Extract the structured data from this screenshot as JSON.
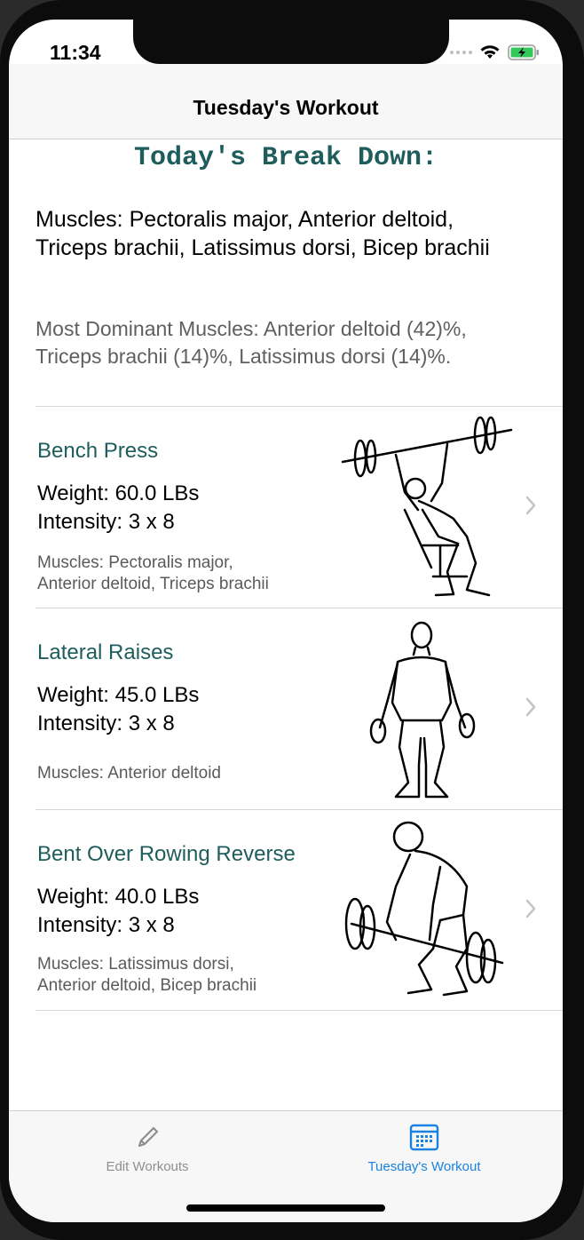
{
  "status": {
    "time": "11:34"
  },
  "nav": {
    "title": "Tuesday's Workout"
  },
  "summary": {
    "heading": "Today's Break Down:",
    "muscles_line1": "Muscles: Pectoralis major, Anterior deltoid,",
    "muscles_line2": "Triceps brachii, Latissimus dorsi, Bicep brachii",
    "dominant_line1": "Most Dominant Muscles: Anterior deltoid (42)%,",
    "dominant_line2": "Triceps brachii (14)%, Latissimus dorsi (14)%."
  },
  "exercises": [
    {
      "name": "Bench Press",
      "weight": "Weight: 60.0 LBs",
      "intensity": "Intensity: 3 x 8",
      "muscles_line1": "Muscles: Pectoralis major,",
      "muscles_line2": "Anterior deltoid, Triceps brachii",
      "image_icon": "bench-press-illustration"
    },
    {
      "name": "Lateral Raises",
      "weight": "Weight: 45.0 LBs",
      "intensity": "Intensity: 3 x 8",
      "muscles_line1": "Muscles: Anterior deltoid",
      "image_icon": "lateral-raises-illustration"
    },
    {
      "name": "Bent Over Rowing Reverse",
      "weight": "Weight: 40.0 LBs",
      "intensity": "Intensity: 3 x 8",
      "muscles_line1": "Muscles: Latissimus dorsi,",
      "muscles_line2": "Anterior deltoid, Bicep brachii",
      "image_icon": "bent-over-row-illustration"
    }
  ],
  "tabs": [
    {
      "label": "Edit Workouts",
      "icon": "pencil-icon",
      "selected": false
    },
    {
      "label": "Tuesday's Workout",
      "icon": "calendar-icon",
      "selected": true
    }
  ],
  "colors": {
    "accent": "#1f5d5d",
    "tab_selected": "#1a82e0",
    "tab_unselected": "#8e8e93"
  }
}
